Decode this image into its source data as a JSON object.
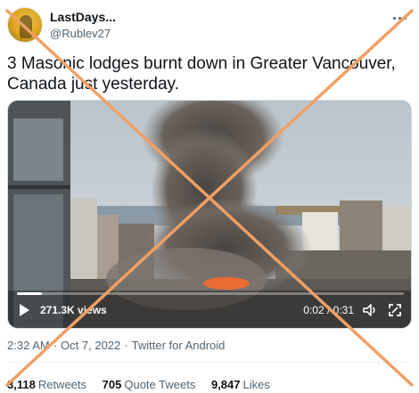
{
  "user": {
    "display_name": "LastDays...",
    "handle": "@Rublev27"
  },
  "tweet": {
    "text": "3 Masonic lodges burnt down in Greater Vancouver, Canada just yesterday."
  },
  "video": {
    "views": "271.3K views",
    "time": "0:02 / 0:31",
    "progress": 0.065
  },
  "meta": {
    "time": "2:32 AM",
    "date": "Oct 7, 2022",
    "source": "Twitter for Android"
  },
  "stats": {
    "retweets_count": "3,118",
    "retweets_label": "Retweets",
    "quotes_count": "705",
    "quotes_label": "Quote Tweets",
    "likes_count": "9,847",
    "likes_label": "Likes"
  },
  "colors": {
    "cross": "#f0a064",
    "text_secondary": "#536471"
  },
  "icons": [
    "more-icon",
    "play-icon",
    "volume-icon",
    "fullscreen-icon"
  ]
}
